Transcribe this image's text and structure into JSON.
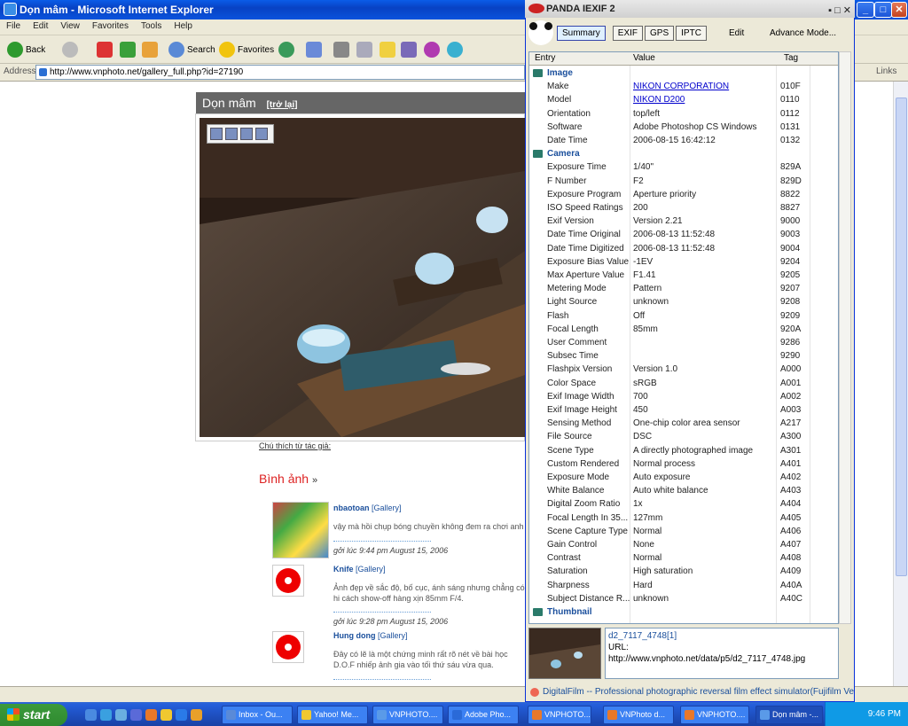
{
  "ie": {
    "title": "Dọn mâm - Microsoft Internet Explorer",
    "menu": [
      "File",
      "Edit",
      "View",
      "Favorites",
      "Tools",
      "Help"
    ],
    "toolbar": {
      "back": "Back",
      "search": "Search",
      "favorites": "Favorites"
    },
    "address_label": "Address",
    "url": "http://www.vnphoto.net/gallery_full.php?id=27190",
    "links": "Links"
  },
  "page": {
    "gallery_title": "Dọn mâm",
    "back_link": "[trở lại]",
    "caption": "Chú thích từ tác giả:",
    "comments_heading": "Bình ảnh",
    "comments_arrow": "»",
    "comments": [
      {
        "name": "nbaotoan",
        "gallery": "[Gallery]",
        "body": "vậy mà hồi chụp bóng chuyền không đem ra chơi anh ui",
        "time": "gởi lúc 9:44 pm August 15, 2006"
      },
      {
        "name": "Knife",
        "gallery": "[Gallery]",
        "body": "Ảnh đẹp về sắc độ, bố cục, ánh sáng nhưng chẳng có hi cách show-off hàng xịn 85mm F/4.",
        "time": "gởi lúc 9:28 pm August 15, 2006"
      },
      {
        "name": "Hung dong",
        "gallery": "[Gallery]",
        "body": "Đây có lẽ là một chứng minh rất rõ nét về bài học D.O.F nhiếp ảnh gia vào tối thứ sáu vừa qua.",
        "time": ""
      }
    ]
  },
  "panda": {
    "title": "PANDA IEXIF 2",
    "tabs": [
      "Summary",
      "EXIF",
      "GPS",
      "IPTC"
    ],
    "edit": "Edit",
    "advance": "Advance Mode...",
    "headers": {
      "entry": "Entry",
      "value": "Value",
      "tag": "Tag"
    },
    "rows": [
      {
        "section": "Image"
      },
      {
        "e": "Make",
        "v": "NIKON CORPORATION",
        "t": "010F",
        "link": true
      },
      {
        "e": "Model",
        "v": "NIKON D200",
        "t": "0110",
        "link": true
      },
      {
        "e": "Orientation",
        "v": "top/left",
        "t": "0112"
      },
      {
        "e": "Software",
        "v": "Adobe Photoshop CS Windows",
        "t": "0131"
      },
      {
        "e": "Date Time",
        "v": "2006-08-15 16:42:12",
        "t": "0132"
      },
      {
        "section": "Camera"
      },
      {
        "e": "Exposure Time",
        "v": "1/40\"",
        "t": "829A"
      },
      {
        "e": "F Number",
        "v": "F2",
        "t": "829D"
      },
      {
        "e": "Exposure Program",
        "v": "Aperture priority",
        "t": "8822"
      },
      {
        "e": "ISO Speed Ratings",
        "v": "200",
        "t": "8827"
      },
      {
        "e": "Exif Version",
        "v": "Version 2.21",
        "t": "9000"
      },
      {
        "e": "Date Time Original",
        "v": "2006-08-13 11:52:48",
        "t": "9003"
      },
      {
        "e": "Date Time Digitized",
        "v": "2006-08-13 11:52:48",
        "t": "9004"
      },
      {
        "e": "Exposure Bias Value",
        "v": "-1EV",
        "t": "9204"
      },
      {
        "e": "Max Aperture Value",
        "v": "F1.41",
        "t": "9205"
      },
      {
        "e": "Metering Mode",
        "v": "Pattern",
        "t": "9207"
      },
      {
        "e": "Light Source",
        "v": "unknown",
        "t": "9208"
      },
      {
        "e": "Flash",
        "v": "Off",
        "t": "9209"
      },
      {
        "e": "Focal Length",
        "v": "85mm",
        "t": "920A"
      },
      {
        "e": "User Comment",
        "v": "",
        "t": "9286"
      },
      {
        "e": "Subsec Time",
        "v": "",
        "t": "9290"
      },
      {
        "e": "Flashpix Version",
        "v": "Version 1.0",
        "t": "A000"
      },
      {
        "e": "Color Space",
        "v": "sRGB",
        "t": "A001"
      },
      {
        "e": "Exif Image Width",
        "v": "700",
        "t": "A002"
      },
      {
        "e": "Exif Image Height",
        "v": "450",
        "t": "A003"
      },
      {
        "e": "Sensing Method",
        "v": "One-chip color area sensor",
        "t": "A217"
      },
      {
        "e": "File Source",
        "v": "DSC",
        "t": "A300"
      },
      {
        "e": "Scene Type",
        "v": "A directly photographed image",
        "t": "A301"
      },
      {
        "e": "Custom Rendered",
        "v": "Normal process",
        "t": "A401"
      },
      {
        "e": "Exposure Mode",
        "v": "Auto exposure",
        "t": "A402"
      },
      {
        "e": "White Balance",
        "v": "Auto white balance",
        "t": "A403"
      },
      {
        "e": "Digital Zoom Ratio",
        "v": "1x",
        "t": "A404"
      },
      {
        "e": "Focal Length In 35...",
        "v": "127mm",
        "t": "A405"
      },
      {
        "e": "Scene Capture Type",
        "v": "Normal",
        "t": "A406"
      },
      {
        "e": "Gain Control",
        "v": "None",
        "t": "A407"
      },
      {
        "e": "Contrast",
        "v": "Normal",
        "t": "A408"
      },
      {
        "e": "Saturation",
        "v": "High saturation",
        "t": "A409"
      },
      {
        "e": "Sharpness",
        "v": "Hard",
        "t": "A40A"
      },
      {
        "e": "Subject Distance R...",
        "v": "unknown",
        "t": "A40C"
      },
      {
        "section": "Thumbnail"
      }
    ],
    "filename": "d2_7117_4748[1]",
    "url_label": "URL:",
    "url": "http://www.vnphoto.net/data/p5/d2_7117_4748.jpg",
    "status": "DigitalFilm -- Professional photographic reversal film effect simulator(Fujifilm Ve"
  },
  "taskbar": {
    "start": "start",
    "tasks": [
      "Inbox - Ou...",
      "Yahoo! Me...",
      "VNPHOTO....",
      "Adobe Pho...",
      "VNPHOTO....",
      "VNPhoto d...",
      "VNPHOTO....",
      "Dọn mâm -..."
    ],
    "clock": "9:46 PM"
  }
}
